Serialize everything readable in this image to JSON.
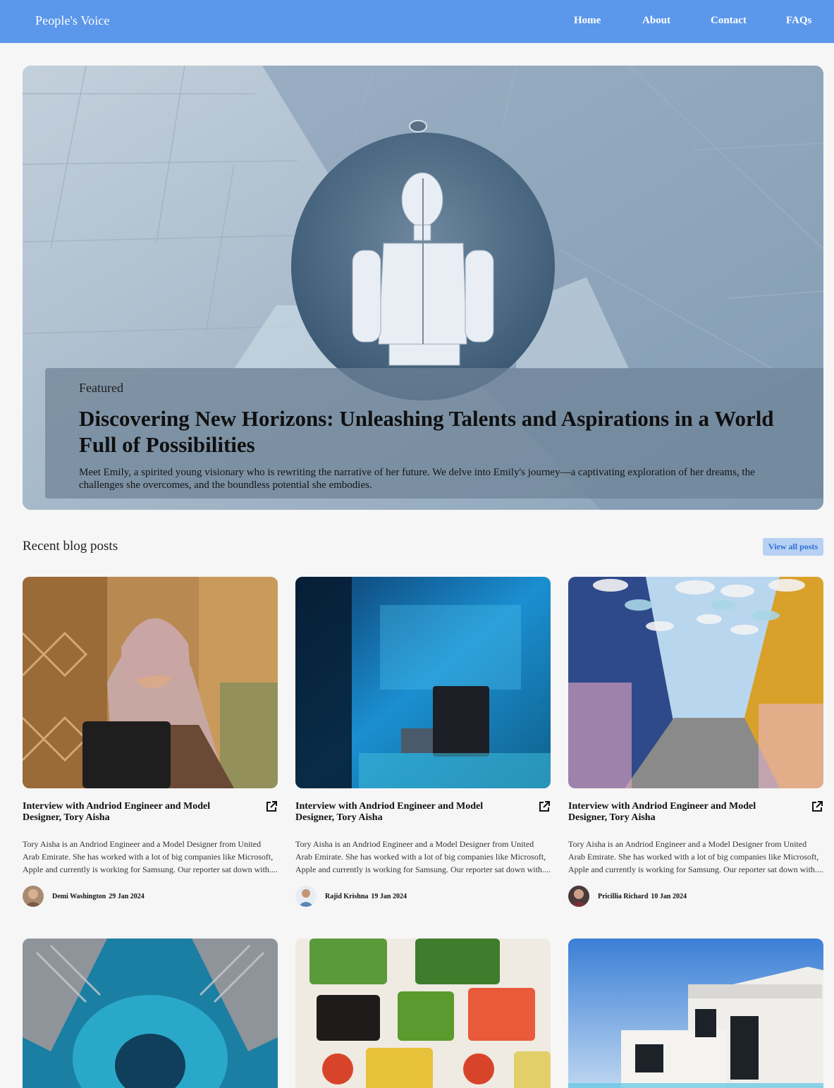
{
  "nav": {
    "brand": "People's Voice",
    "links": [
      "Home",
      "About",
      "Contact",
      "FAQs"
    ]
  },
  "hero": {
    "tag": "Featured",
    "title": "Discovering New Horizons: Unleashing Talents and Aspirations in a World Full of Possibilities",
    "description": "Meet Emily, a spirited young visionary who is rewriting the narrative of her future. We delve into Emily's journey—a captivating exploration of her dreams, the challenges she overcomes, and the boundless potential she embodies."
  },
  "recent": {
    "title": "Recent blog posts",
    "view_all": "View all posts"
  },
  "posts": [
    {
      "title": "Interview with Andriod Engineer and Model Designer, Tory Aisha",
      "description": "Tory Aisha is an Andriod Engineer and a Model Designer from United Arab Emirate. She has worked with a lot of big companies like Microsoft, Apple and currently is working for Samsung. Our reporter sat down with....",
      "author": "Demi Washington",
      "date": "29 Jan 2024"
    },
    {
      "title": "Interview with Andriod Engineer and Model Designer, Tory Aisha",
      "description": "Tory Aisha is an Andriod Engineer and a Model Designer from United Arab Emirate. She has worked with a lot of big companies like Microsoft, Apple and currently is working for Samsung. Our reporter sat down with....",
      "author": "Rajid Krishna",
      "date": "19 Jan 2024"
    },
    {
      "title": "Interview with Andriod Engineer and Model Designer, Tory Aisha",
      "description": "Tory Aisha is an Andriod Engineer and a Model Designer from United Arab Emirate. She has worked with a lot of big companies like Microsoft, Apple and currently is working for Samsung. Our reporter sat down with....",
      "author": "Pricillia Richard",
      "date": "10 Jan 2024"
    }
  ],
  "colors": {
    "nav_bg": "#5b97ea",
    "page_bg": "#f6f6f6",
    "button_bg": "#b6d1f3",
    "button_text": "#2f6fd1"
  },
  "icons": [
    "external-link-icon"
  ]
}
